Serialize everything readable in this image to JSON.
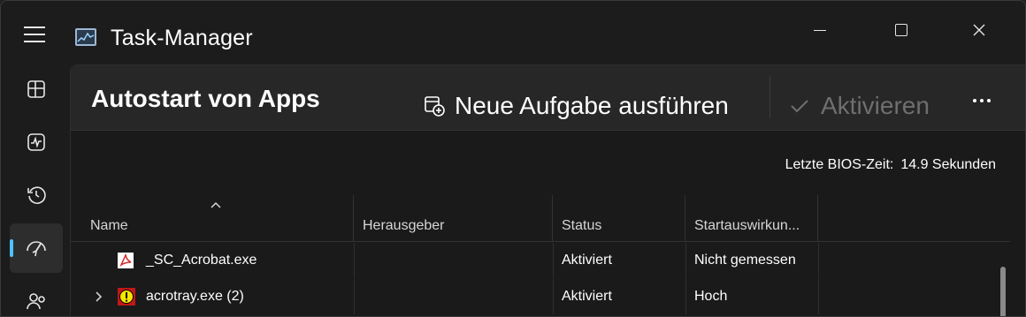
{
  "window": {
    "title": "Task-Manager"
  },
  "header": {
    "title": "Autostart von Apps",
    "new_task_label": "Neue Aufgabe ausführen",
    "activate_label": "Aktivieren"
  },
  "bios": {
    "label": "Letzte BIOS-Zeit:",
    "value": "14.9 Sekunden"
  },
  "table": {
    "columns": [
      "Name",
      "Herausgeber",
      "Status",
      "Startauswirkun..."
    ],
    "rows": [
      {
        "name": "_SC_Acrobat.exe",
        "publisher": "",
        "status": "Aktiviert",
        "impact": "Nicht gemessen"
      },
      {
        "name": "acrotray.exe (2)",
        "publisher": "",
        "status": "Aktiviert",
        "impact": "Hoch"
      }
    ]
  },
  "colors": {
    "accent": "#4cc2ff",
    "background": "#1a1a1a",
    "header_bg": "#272727",
    "disabled_text": "#6f6f6f"
  },
  "icons": {
    "menu": "hamburger-icon",
    "app": "task-manager-icon",
    "nav": [
      "processes-icon",
      "performance-icon",
      "app-history-icon",
      "startup-apps-icon",
      "users-icon"
    ],
    "new_task": "new-task-icon",
    "activate": "checkmark-icon",
    "more": "more-options-icon"
  }
}
